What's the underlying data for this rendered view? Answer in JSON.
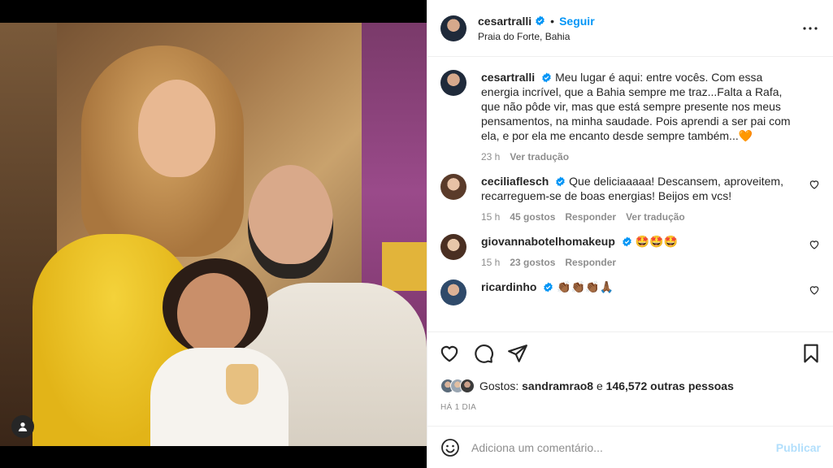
{
  "post": {
    "author": "cesartralli",
    "follow_label": "Seguir",
    "dot": "•",
    "location": "Praia do Forte, Bahia",
    "caption_author": "cesartralli",
    "caption": "Meu lugar é aqui: entre vocês. Com essa energia incrível, que a Bahia sempre me traz...Falta a Rafa, que não pôde vir, mas que está sempre presente nos meus pensamentos, na minha saudade. Pois aprendi a ser pai com ela, e por ela me encanto desde sempre também...🧡",
    "caption_time": "23 h",
    "caption_translate": "Ver tradução"
  },
  "comments": [
    {
      "username": "ceciliaflesch",
      "text": "Que deliciaaaaa! Descansem, aproveitem, recarreguem-se de boas energias! Beijos em vcs!",
      "time": "15 h",
      "likes": "45 gostos",
      "reply": "Responder",
      "translate": "Ver tradução"
    },
    {
      "username": "giovannabotelhomakeup",
      "text": "🤩🤩🤩",
      "time": "15 h",
      "likes": "23 gostos",
      "reply": "Responder"
    },
    {
      "username": "ricardinho",
      "text": "👏🏾👏🏾👏🏾🙏🏾"
    }
  ],
  "likes": {
    "prefix": "Gostos:",
    "user": "sandramrao8",
    "connector": "e",
    "others": "146,572 outras pessoas"
  },
  "date": "HÁ 1 DIA",
  "add_comment": {
    "placeholder": "Adiciona um comentário...",
    "publish": "Publicar"
  },
  "icons": {
    "like": "heart-icon",
    "comment": "comment-icon",
    "share": "share-icon",
    "save": "bookmark-icon",
    "more": "more-icon",
    "emoji": "emoji-icon",
    "tag": "user-tag-icon"
  },
  "colors": {
    "link": "#0095f6",
    "publish_disabled": "#b2dffc",
    "secondary_text": "#8e8e8e"
  }
}
